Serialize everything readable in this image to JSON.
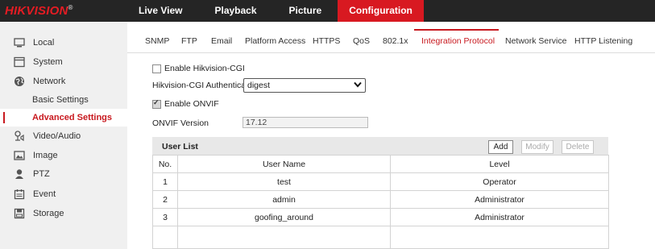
{
  "brand": {
    "logo": "HIKVISION",
    "registered": "®"
  },
  "topnav": [
    {
      "label": "Live View"
    },
    {
      "label": "Playback"
    },
    {
      "label": "Picture"
    },
    {
      "label": "Configuration",
      "active": true
    }
  ],
  "sidebar": {
    "items": [
      {
        "label": "Local",
        "icon": "monitor-icon"
      },
      {
        "label": "System",
        "icon": "system-icon"
      },
      {
        "label": "Network",
        "icon": "globe-icon"
      },
      {
        "label": "Basic Settings"
      },
      {
        "label": "Advanced Settings",
        "active": true
      },
      {
        "label": "Video/Audio",
        "icon": "video-audio-icon"
      },
      {
        "label": "Image",
        "icon": "image-icon"
      },
      {
        "label": "PTZ",
        "icon": "ptz-icon"
      },
      {
        "label": "Event",
        "icon": "event-icon"
      },
      {
        "label": "Storage",
        "icon": "storage-icon"
      }
    ]
  },
  "tabs": [
    {
      "label": "SNMP"
    },
    {
      "label": "FTP"
    },
    {
      "label": "Email"
    },
    {
      "label": "Platform Access"
    },
    {
      "label": "HTTPS"
    },
    {
      "label": "QoS"
    },
    {
      "label": "802.1x"
    },
    {
      "label": "Integration Protocol",
      "active": true
    },
    {
      "label": "Network Service"
    },
    {
      "label": "HTTP Listening"
    }
  ],
  "form": {
    "enable_cgi_label": "Enable Hikvision-CGI",
    "enable_cgi_checked": false,
    "auth_label": "Hikvision-CGI Authenticat...",
    "auth_value": "digest",
    "enable_onvif_label": "Enable ONVIF",
    "enable_onvif_checked": true,
    "onvif_version_label": "ONVIF Version",
    "onvif_version_value": "17.12"
  },
  "user_list": {
    "title": "User List",
    "add_label": "Add",
    "modify_label": "Modify",
    "delete_label": "Delete",
    "columns": [
      "No.",
      "User Name",
      "Level"
    ],
    "rows": [
      {
        "no": "1",
        "name": "test",
        "level": "Operator"
      },
      {
        "no": "2",
        "name": "admin",
        "level": "Administrator"
      },
      {
        "no": "3",
        "name": "goofing_around",
        "level": "Administrator"
      }
    ]
  },
  "colors": {
    "accent": "#d81921",
    "topbar": "#252525",
    "sidebar": "#f0f0f0"
  }
}
